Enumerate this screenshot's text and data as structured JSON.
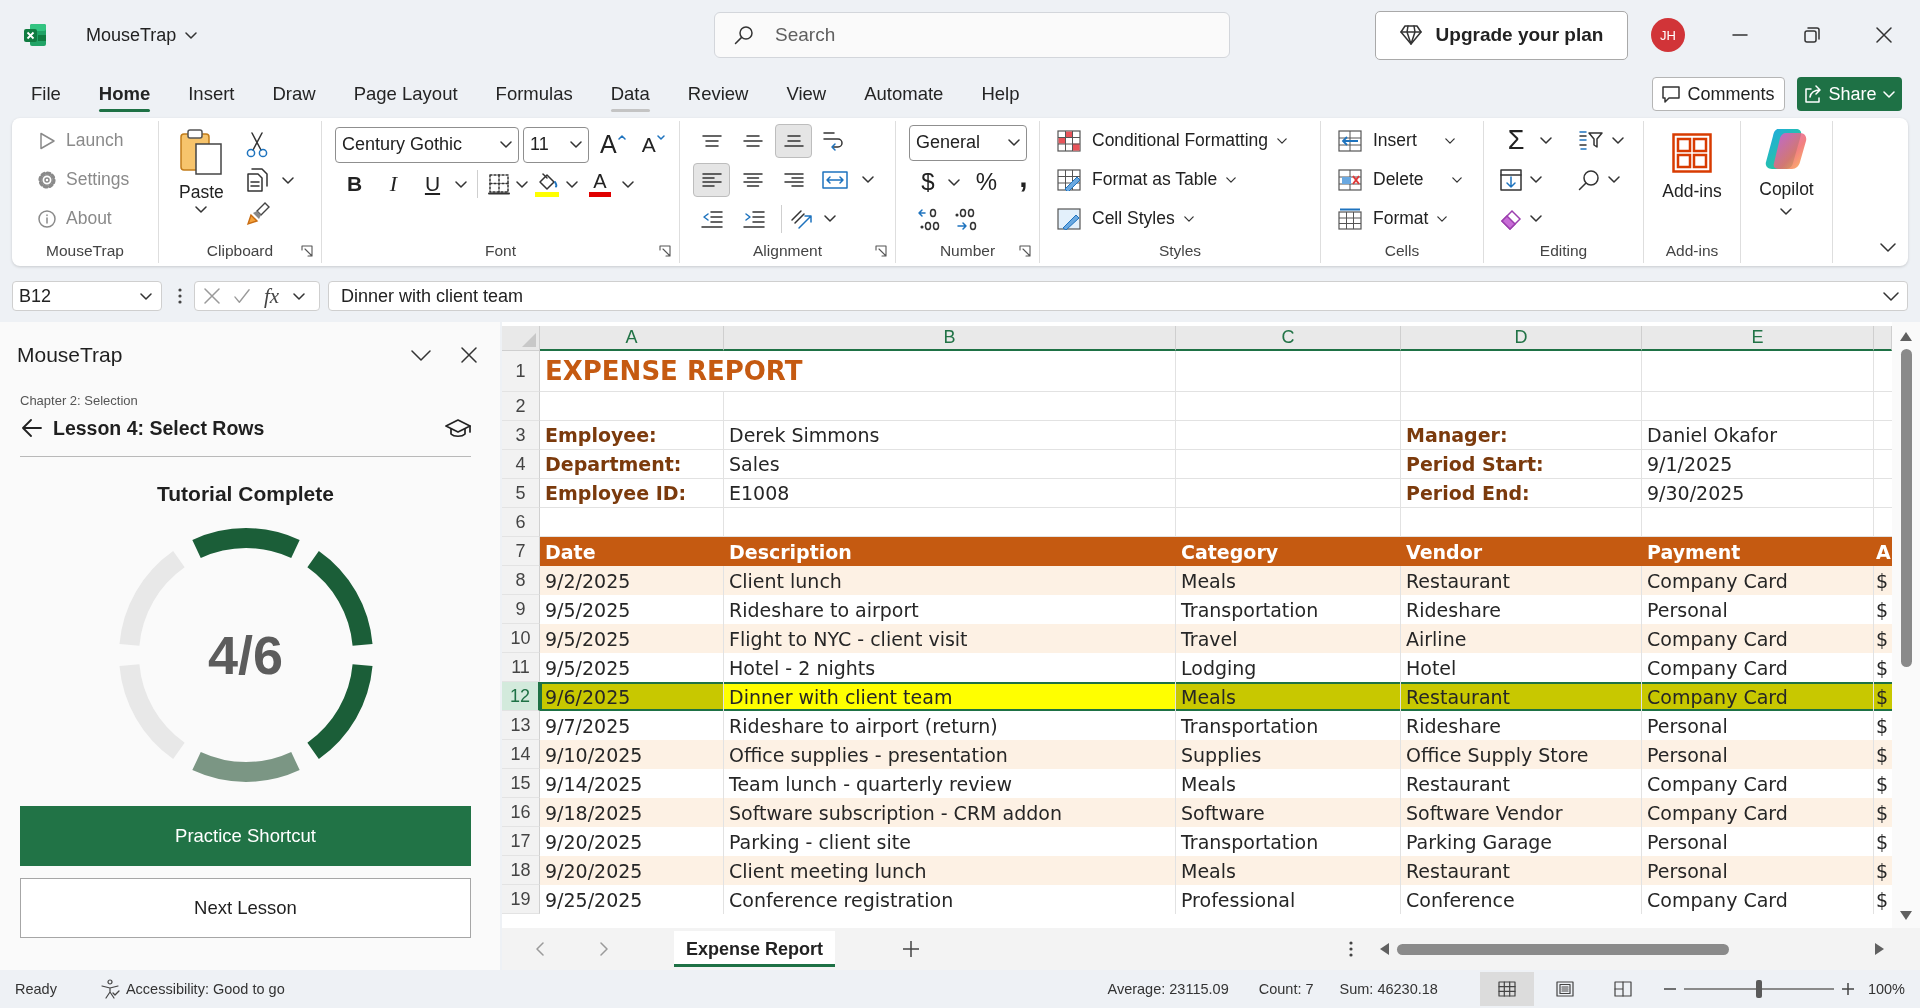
{
  "title_bar": {
    "document_title": "MouseTrap",
    "search": {
      "placeholder": "Search"
    },
    "upgrade_button": "Upgrade your plan",
    "avatar_initials": "JH"
  },
  "menu_tabs": [
    {
      "label": "File",
      "selected": false,
      "hovered": false
    },
    {
      "label": "Home",
      "selected": true,
      "hovered": false
    },
    {
      "label": "Insert",
      "selected": false,
      "hovered": false
    },
    {
      "label": "Draw",
      "selected": false,
      "hovered": false
    },
    {
      "label": "Page Layout",
      "selected": false,
      "hovered": false
    },
    {
      "label": "Formulas",
      "selected": false,
      "hovered": false
    },
    {
      "label": "Data",
      "selected": false,
      "hovered": true
    },
    {
      "label": "Review",
      "selected": false,
      "hovered": false
    },
    {
      "label": "View",
      "selected": false,
      "hovered": false
    },
    {
      "label": "Automate",
      "selected": false,
      "hovered": false
    },
    {
      "label": "Help",
      "selected": false,
      "hovered": false
    }
  ],
  "comments_button": "Comments",
  "share_button": "Share",
  "ribbon": {
    "groups": [
      {
        "kind": "mousetrap",
        "label": "MouseTrap",
        "items": [
          {
            "kind": "launch",
            "label": "Launch",
            "disabled": true
          },
          {
            "kind": "settings",
            "label": "Settings",
            "disabled": true
          },
          {
            "kind": "about",
            "label": "About",
            "disabled": true
          }
        ]
      },
      {
        "kind": "clipboard",
        "label": "Clipboard",
        "paste_label": "Paste"
      },
      {
        "kind": "font",
        "label": "Font",
        "font_name": "Century Gothic",
        "font_size": "11",
        "grow_glyph": "A",
        "shrink_glyph": "A",
        "bold_glyph": "B",
        "italic_glyph": "I",
        "underline_glyph": "U",
        "font_color_glyph": "A"
      },
      {
        "kind": "alignment",
        "label": "Alignment",
        "buttons": [
          {
            "kind": "top",
            "pressed": false
          },
          {
            "kind": "middle",
            "pressed": false
          },
          {
            "kind": "bottom",
            "pressed": true
          },
          {
            "kind": "left",
            "pressed": true
          },
          {
            "kind": "center",
            "pressed": false
          },
          {
            "kind": "right",
            "pressed": false
          }
        ]
      },
      {
        "kind": "number",
        "label": "Number",
        "format": "General",
        "currency_glyph": "$",
        "percent_glyph": "%",
        "comma_glyph": ","
      },
      {
        "kind": "styles",
        "label": "Styles",
        "items": [
          {
            "kind": "conditional_formatting",
            "label": "Conditional Formatting"
          },
          {
            "kind": "format_as_table",
            "label": "Format as Table"
          },
          {
            "kind": "cell_styles",
            "label": "Cell Styles"
          }
        ]
      },
      {
        "kind": "cells",
        "label": "Cells",
        "items": [
          {
            "kind": "insert",
            "label": "Insert"
          },
          {
            "kind": "delete",
            "label": "Delete"
          },
          {
            "kind": "format",
            "label": "Format"
          }
        ]
      },
      {
        "kind": "editing",
        "label": "Editing",
        "sum_glyph": "Σ"
      },
      {
        "kind": "addins",
        "label": "Add-ins",
        "button_label": "Add-ins"
      },
      {
        "kind": "copilot",
        "button_label": "Copilot"
      }
    ]
  },
  "formula_bar": {
    "name_box": "B12",
    "fx": "fx",
    "formula": "Dinner with client team"
  },
  "task_pane": {
    "title": "MouseTrap",
    "chapter": "Chapter 2: Selection",
    "lesson": "Lesson 4: Select Rows",
    "heading": "Tutorial Complete",
    "progress": {
      "label": "4/6",
      "segments": [
        {
          "completed": true,
          "current": false
        },
        {
          "completed": true,
          "current": false
        },
        {
          "completed": true,
          "current": false
        },
        {
          "completed": true,
          "current": true
        },
        {
          "completed": false,
          "current": false
        },
        {
          "completed": false,
          "current": false
        }
      ]
    },
    "buttons": [
      {
        "kind": "primary",
        "label": "Practice Shortcut"
      },
      {
        "kind": "secondary",
        "label": "Next Lesson"
      }
    ]
  },
  "sheet": {
    "columns": [
      "A",
      "B",
      "C",
      "D",
      "E"
    ],
    "rows": [
      {
        "kind": "title",
        "number": "1",
        "text": "EXPENSE REPORT"
      },
      {
        "kind": "blank",
        "number": "2"
      },
      {
        "kind": "info",
        "number": "3",
        "left_label": "Employee:",
        "left_value": "Derek Simmons",
        "right_label": "Manager:",
        "right_value": "Daniel Okafor"
      },
      {
        "kind": "info",
        "number": "4",
        "left_label": "Department:",
        "left_value": "Sales",
        "right_label": "Period Start:",
        "right_value": "9/1/2025"
      },
      {
        "kind": "info",
        "number": "5",
        "left_label": "Employee ID:",
        "left_value": "E1008",
        "right_label": "Period End:",
        "right_value": "9/30/2025"
      },
      {
        "kind": "blank",
        "number": "6"
      },
      {
        "kind": "header",
        "number": "7",
        "cells": [
          "Date",
          "Description",
          "Category",
          "Vendor",
          "Payment",
          "A"
        ]
      },
      {
        "kind": "data",
        "number": "8",
        "selected": false,
        "highlighted": false,
        "cells": [
          {
            "text": "9/2/2025",
            "active": false
          },
          {
            "text": "Client lunch",
            "active": false
          },
          {
            "text": "Meals",
            "active": false
          },
          {
            "text": "Restaurant",
            "active": false
          },
          {
            "text": "Company Card",
            "active": false
          },
          {
            "text": "$",
            "active": false
          }
        ]
      },
      {
        "kind": "data",
        "number": "9",
        "selected": false,
        "highlighted": false,
        "cells": [
          {
            "text": "9/5/2025",
            "active": false
          },
          {
            "text": "Rideshare to airport",
            "active": false
          },
          {
            "text": "Transportation",
            "active": false
          },
          {
            "text": "Rideshare",
            "active": false
          },
          {
            "text": "Personal",
            "active": false
          },
          {
            "text": "$",
            "active": false
          }
        ]
      },
      {
        "kind": "data",
        "number": "10",
        "selected": false,
        "highlighted": false,
        "cells": [
          {
            "text": "9/5/2025",
            "active": false
          },
          {
            "text": "Flight to NYC - client visit",
            "active": false
          },
          {
            "text": "Travel",
            "active": false
          },
          {
            "text": "Airline",
            "active": false
          },
          {
            "text": "Company Card",
            "active": false
          },
          {
            "text": "$",
            "active": false
          }
        ]
      },
      {
        "kind": "data",
        "number": "11",
        "selected": false,
        "highlighted": false,
        "cells": [
          {
            "text": "9/5/2025",
            "active": false
          },
          {
            "text": "Hotel - 2 nights",
            "active": false
          },
          {
            "text": "Lodging",
            "active": false
          },
          {
            "text": "Hotel",
            "active": false
          },
          {
            "text": "Company Card",
            "active": false
          },
          {
            "text": "$",
            "active": false
          }
        ]
      },
      {
        "kind": "data",
        "number": "12",
        "selected": true,
        "highlighted": true,
        "cells": [
          {
            "text": "9/6/2025",
            "active": false
          },
          {
            "text": "Dinner with client team",
            "active": true
          },
          {
            "text": "Meals",
            "active": false
          },
          {
            "text": "Restaurant",
            "active": false
          },
          {
            "text": "Company Card",
            "active": false
          },
          {
            "text": "$",
            "active": false
          }
        ]
      },
      {
        "kind": "data",
        "number": "13",
        "selected": false,
        "highlighted": false,
        "cells": [
          {
            "text": "9/7/2025",
            "active": false
          },
          {
            "text": "Rideshare to airport (return)",
            "active": false
          },
          {
            "text": "Transportation",
            "active": false
          },
          {
            "text": "Rideshare",
            "active": false
          },
          {
            "text": "Personal",
            "active": false
          },
          {
            "text": "$",
            "active": false
          }
        ]
      },
      {
        "kind": "data",
        "number": "14",
        "selected": false,
        "highlighted": false,
        "cells": [
          {
            "text": "9/10/2025",
            "active": false
          },
          {
            "text": "Office supplies - presentation",
            "active": false
          },
          {
            "text": "Supplies",
            "active": false
          },
          {
            "text": "Office Supply Store",
            "active": false
          },
          {
            "text": "Personal",
            "active": false
          },
          {
            "text": "$",
            "active": false
          }
        ]
      },
      {
        "kind": "data",
        "number": "15",
        "selected": false,
        "highlighted": false,
        "cells": [
          {
            "text": "9/14/2025",
            "active": false
          },
          {
            "text": "Team lunch - quarterly review",
            "active": false
          },
          {
            "text": "Meals",
            "active": false
          },
          {
            "text": "Restaurant",
            "active": false
          },
          {
            "text": "Company Card",
            "active": false
          },
          {
            "text": "$",
            "active": false
          }
        ]
      },
      {
        "kind": "data",
        "number": "16",
        "selected": false,
        "highlighted": false,
        "cells": [
          {
            "text": "9/18/2025",
            "active": false
          },
          {
            "text": "Software subscription - CRM addon",
            "active": false
          },
          {
            "text": "Software",
            "active": false
          },
          {
            "text": "Software Vendor",
            "active": false
          },
          {
            "text": "Company Card",
            "active": false
          },
          {
            "text": "$",
            "active": false
          }
        ]
      },
      {
        "kind": "data",
        "number": "17",
        "selected": false,
        "highlighted": false,
        "cells": [
          {
            "text": "9/20/2025",
            "active": false
          },
          {
            "text": "Parking - client site",
            "active": false
          },
          {
            "text": "Transportation",
            "active": false
          },
          {
            "text": "Parking Garage",
            "active": false
          },
          {
            "text": "Personal",
            "active": false
          },
          {
            "text": "$",
            "active": false
          }
        ]
      },
      {
        "kind": "data",
        "number": "18",
        "selected": false,
        "highlighted": false,
        "cells": [
          {
            "text": "9/20/2025",
            "active": false
          },
          {
            "text": "Client meeting lunch",
            "active": false
          },
          {
            "text": "Meals",
            "active": false
          },
          {
            "text": "Restaurant",
            "active": false
          },
          {
            "text": "Personal",
            "active": false
          },
          {
            "text": "$",
            "active": false
          }
        ]
      },
      {
        "kind": "data",
        "number": "19",
        "selected": false,
        "highlighted": false,
        "cells": [
          {
            "text": "9/25/2025",
            "active": false
          },
          {
            "text": "Conference registration",
            "active": false
          },
          {
            "text": "Professional",
            "active": false
          },
          {
            "text": "Conference",
            "active": false
          },
          {
            "text": "Company Card",
            "active": false
          },
          {
            "text": "$",
            "active": false
          }
        ]
      }
    ]
  },
  "sheet_tabs": [
    {
      "label": "Expense Report",
      "selected": true
    }
  ],
  "status_bar": {
    "mode": "Ready",
    "accessibility": "Accessibility: Good to go",
    "average": "Average: 23115.09",
    "count": "Count: 7",
    "sum": "Sum: 46230.18",
    "views": [
      {
        "kind": "normal",
        "selected": true
      },
      {
        "kind": "page_layout",
        "selected": false
      },
      {
        "kind": "page_break",
        "selected": false
      }
    ],
    "zoom": {
      "level": 0.5,
      "reading": "100%"
    }
  }
}
